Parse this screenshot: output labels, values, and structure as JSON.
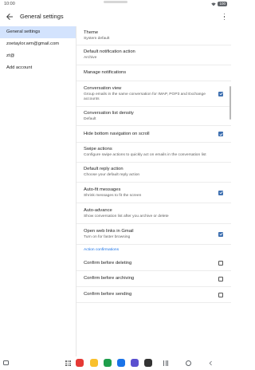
{
  "status_bar": {
    "time": "10:00",
    "battery": "100"
  },
  "header": {
    "title": "General settings"
  },
  "sidebar": {
    "items": [
      {
        "label": "General settings",
        "active": true
      },
      {
        "label": "zoetaylor.wm@gmail.com",
        "active": false
      },
      {
        "label": "zt@",
        "active": false
      },
      {
        "label": "Add account",
        "active": false
      }
    ]
  },
  "settings": [
    {
      "title": "Theme",
      "desc": "System default",
      "checkbox": null
    },
    {
      "title": "Default notification action",
      "desc": "Archive",
      "checkbox": null
    },
    {
      "title": "Manage notifications",
      "desc": "",
      "checkbox": null
    },
    {
      "title": "Conversation view",
      "desc": "Group emails in the same conversation for IMAP, POP3 and Exchange accounts",
      "checkbox": true
    },
    {
      "title": "Conversation list density",
      "desc": "Default",
      "checkbox": null
    },
    {
      "title": "Hide bottom navigation on scroll",
      "desc": "",
      "checkbox": true
    },
    {
      "title": "Swipe actions",
      "desc": "Configure swipe actions to quickly act on emails in the conversation list",
      "checkbox": null
    },
    {
      "title": "Default reply action",
      "desc": "Choose your default reply action",
      "checkbox": null
    },
    {
      "title": "Auto-fit messages",
      "desc": "Shrink messages to fit the screen",
      "checkbox": true
    },
    {
      "title": "Auto-advance",
      "desc": "Show conversation list after you archive or delete",
      "checkbox": null
    },
    {
      "title": "Open web links in Gmail",
      "desc": "Turn on for faster browsing",
      "checkbox": true
    }
  ],
  "action_confirmations": {
    "header": "Action confirmations",
    "items": [
      {
        "title": "Confirm before deleting",
        "checkbox": false
      },
      {
        "title": "Confirm before archiving",
        "checkbox": false
      },
      {
        "title": "Confirm before sending",
        "checkbox": false
      }
    ]
  },
  "dock": {
    "apps": [
      {
        "icon": "red-app-icon",
        "color": "#e53935"
      },
      {
        "icon": "yellow-app-icon",
        "color": "#f9c02c"
      },
      {
        "icon": "phone-app-icon",
        "color": "#1e9e4b"
      },
      {
        "icon": "chat-app-icon",
        "color": "#1a73e8"
      },
      {
        "icon": "samsung-app-icon",
        "color": "#5a4fcf"
      },
      {
        "icon": "camera-app-icon",
        "color": "#333333"
      }
    ]
  },
  "colors": {
    "accent": "#3d6fb0",
    "selected_bg": "#d3e3fd",
    "section_header": "#1a73e8"
  }
}
